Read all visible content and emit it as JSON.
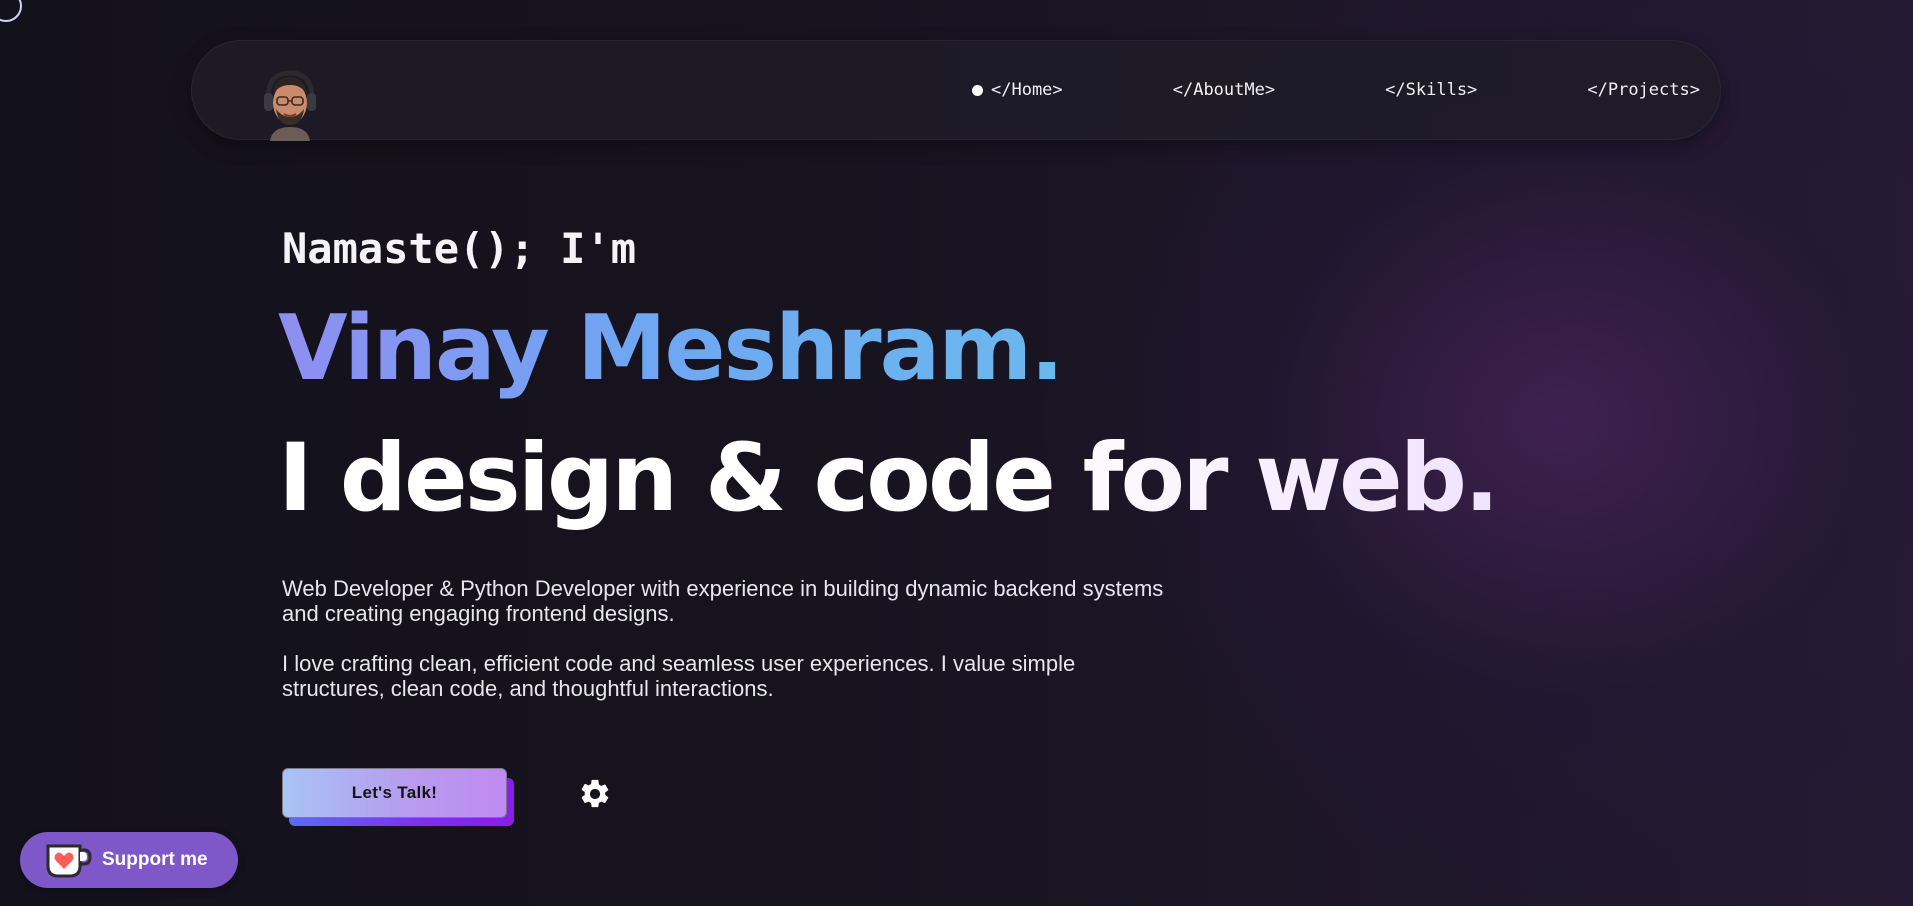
{
  "nav": {
    "items": [
      {
        "label": "</Home>",
        "active": true
      },
      {
        "label": "</AboutMe>",
        "active": false
      },
      {
        "label": "</Skills>",
        "active": false
      },
      {
        "label": "</Projects>",
        "active": false
      }
    ],
    "avatar_icon": "memoji-avatar"
  },
  "hero": {
    "greeting": "Namaste(); I'm",
    "name": "Vinay Meshram.",
    "tagline": "I design & code for web.",
    "description_1": "Web Developer & Python Developer with experience in building dynamic backend systems and creating engaging frontend designs.",
    "description_2": "I love crafting clean, efficient code and seamless user experiences. I value simple structures, clean code, and thoughtful interactions.",
    "cta_label": "Let's Talk!",
    "settings_icon": "gear-icon"
  },
  "support": {
    "label": "Support me",
    "icon": "ko-fi-cup-icon"
  },
  "colors": {
    "background": "#13111c",
    "name_gradient_start": "#8f8ef1",
    "name_gradient_end": "#6bb8ee",
    "cta_gradient_start": "#a7c4f4",
    "cta_gradient_end": "#c08af0",
    "support_bg": "#7e57c8"
  }
}
